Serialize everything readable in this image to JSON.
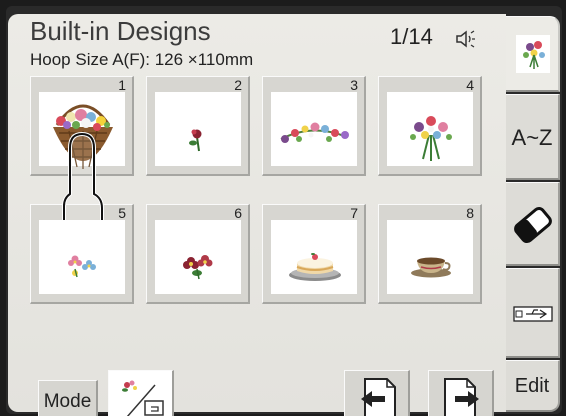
{
  "header": {
    "title": "Built-in Designs",
    "hoop_label": "Hoop Size  A(F): 126 ×110mm",
    "page": "1/14"
  },
  "designs": [
    {
      "number": "1",
      "icon": "flower-basket-icon"
    },
    {
      "number": "2",
      "icon": "single-flower-icon"
    },
    {
      "number": "3",
      "icon": "floral-garland-icon"
    },
    {
      "number": "4",
      "icon": "flower-bouquet-icon"
    },
    {
      "number": "5",
      "icon": "small-flowers-icon"
    },
    {
      "number": "6",
      "icon": "red-flowers-icon"
    },
    {
      "number": "7",
      "icon": "cake-icon"
    },
    {
      "number": "8",
      "icon": "teacup-icon"
    }
  ],
  "bottom_bar": {
    "mode_label": "Mode",
    "convert_icon": "embroidery-to-hoop-icon",
    "prev_icon": "previous-page-icon",
    "next_icon": "next-page-icon"
  },
  "side_tabs": [
    {
      "label": "",
      "icon": "flower-design-icon"
    },
    {
      "label": "A~Z",
      "icon": ""
    },
    {
      "label": "",
      "icon": "eraser-icon"
    },
    {
      "label": "",
      "icon": "usb-icon"
    },
    {
      "label": "Edit",
      "icon": ""
    }
  ],
  "colors": {
    "panel": "#ecebe6",
    "tile": "#d7d6d1",
    "frame": "#2a2a2a"
  }
}
